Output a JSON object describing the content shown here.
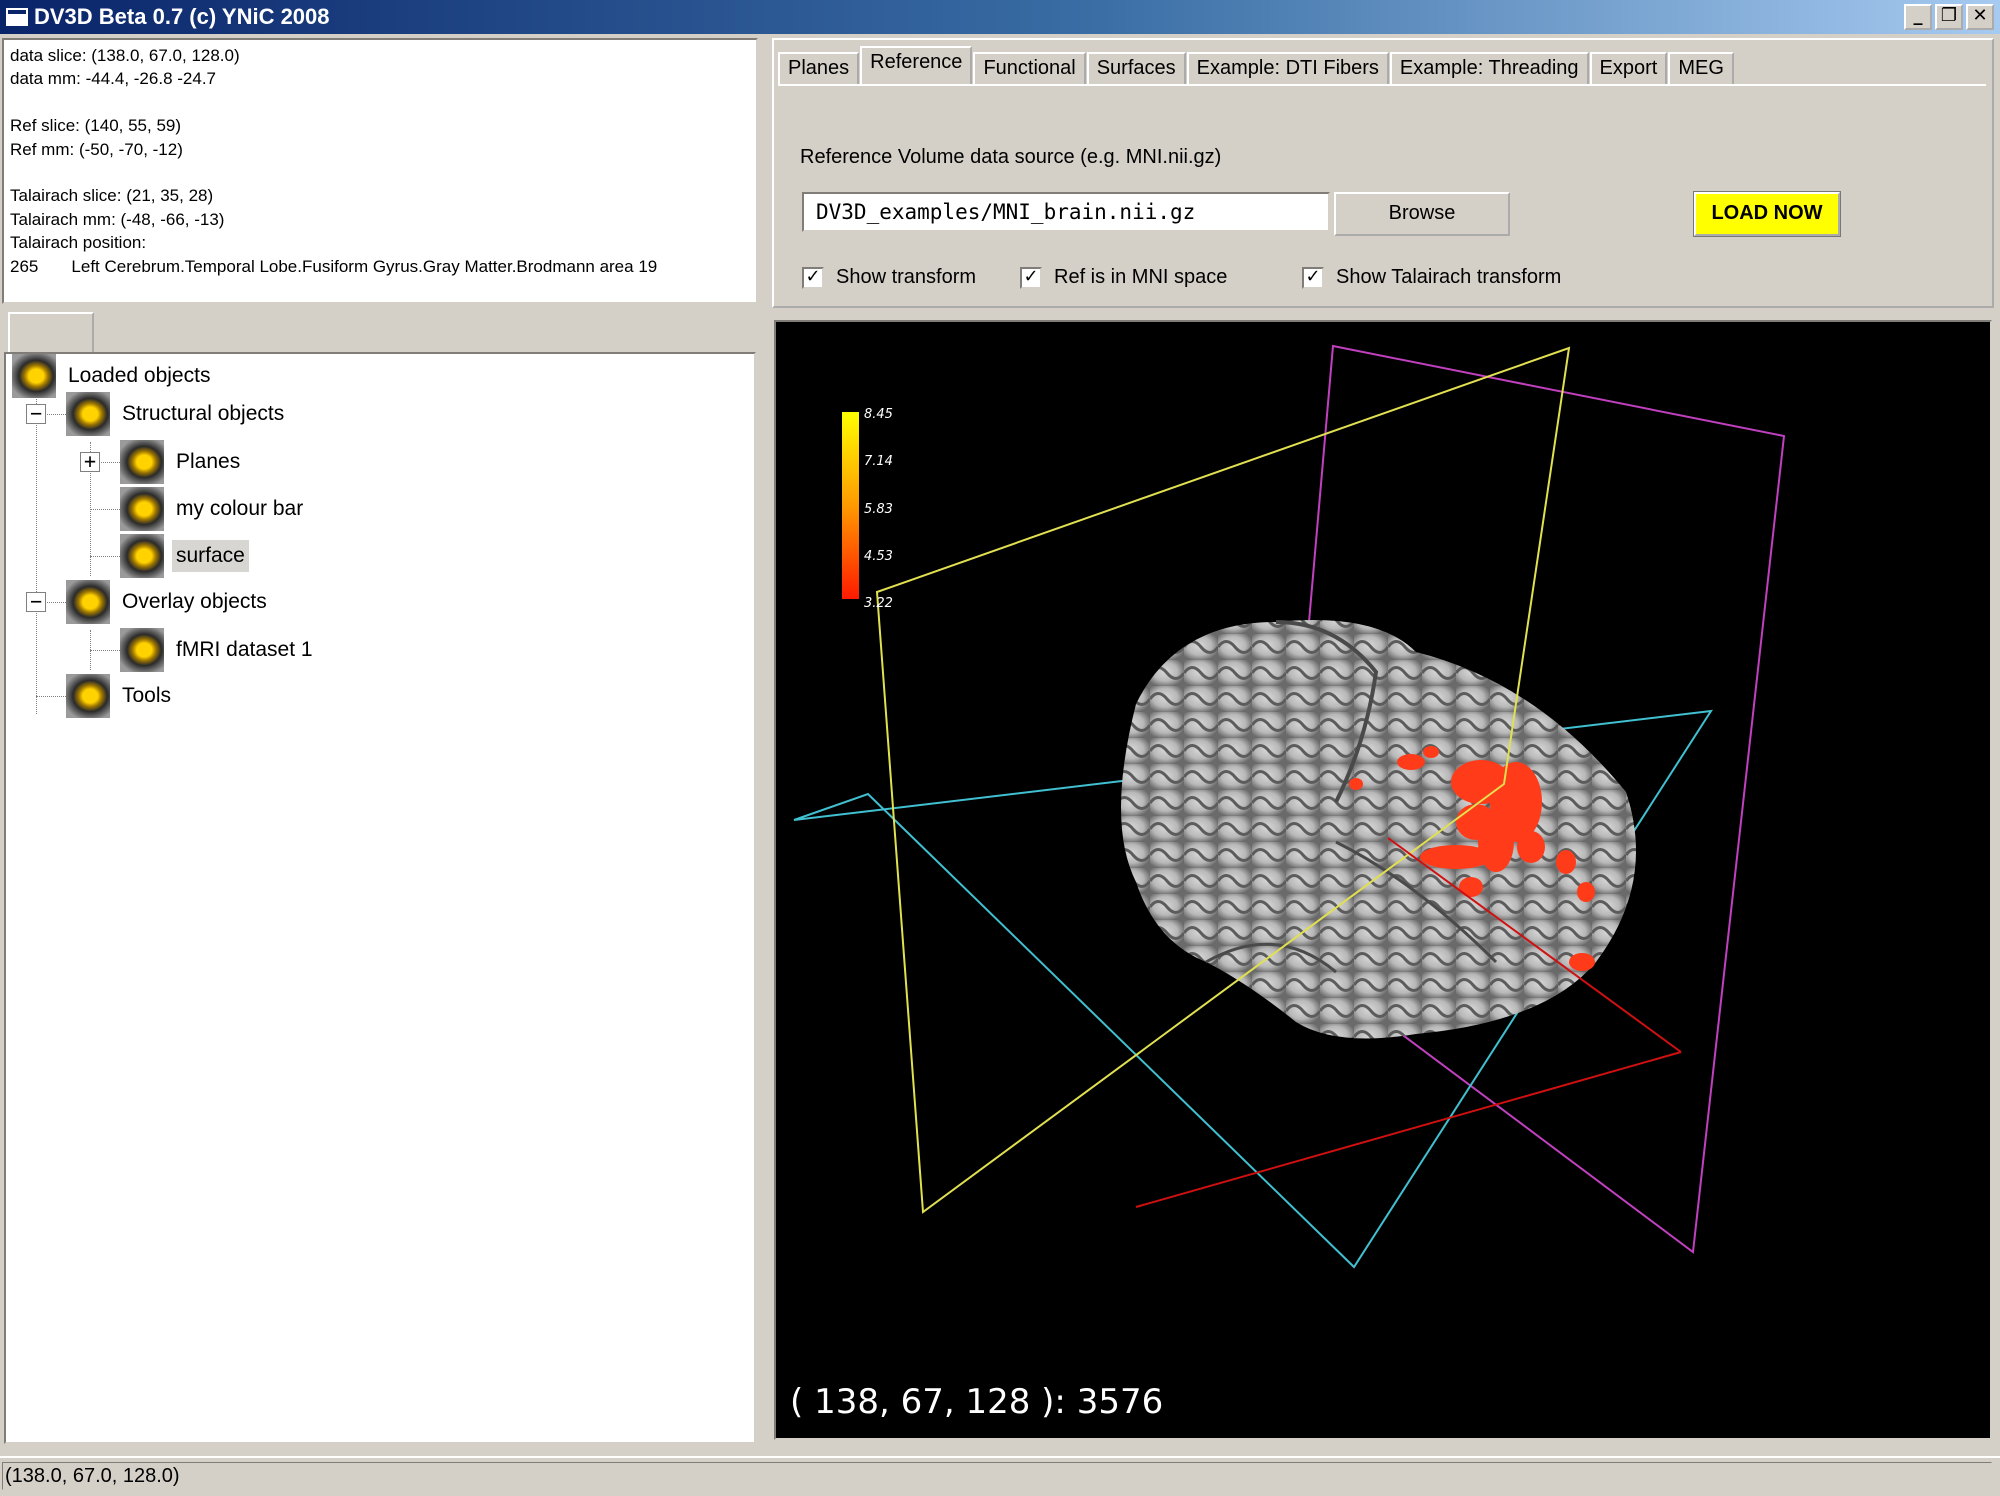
{
  "window": {
    "title": "DV3D Beta 0.7 (c) YNiC 2008",
    "minimize_glyph": "_",
    "restore_glyph": "❐",
    "close_glyph": "✕"
  },
  "info": {
    "lines": [
      "data slice: (138.0, 67.0, 128.0)",
      "data mm: -44.4, -26.8 -24.7",
      "",
      "Ref slice: (140, 55, 59)",
      "Ref mm: (-50, -70, -12)",
      "",
      "Talairach slice: (21, 35, 28)",
      "Talairach mm: (-48, -66, -13)",
      "Talairach position:",
      "265       Left Cerebrum.Temporal Lobe.Fusiform Gyrus.Gray Matter.Brodmann area 19"
    ]
  },
  "tree": {
    "root": "Loaded objects",
    "structural": "Structural objects",
    "planes": "Planes",
    "colour_bar": "my colour bar",
    "surface": "surface",
    "overlay": "Overlay objects",
    "fmri": "fMRI dataset 1",
    "tools": "Tools",
    "collapse_glyph": "−",
    "expand_glyph": "+"
  },
  "tabs": [
    "Planes",
    "Reference",
    "Functional",
    "Surfaces",
    "Example: DTI Fibers",
    "Example: Threading",
    "Export",
    "MEG"
  ],
  "reference": {
    "source_label": "Reference Volume data source (e.g. MNI.nii.gz)",
    "source_value": "DV3D_examples/MNI_brain.nii.gz",
    "browse_label": "Browse",
    "load_label": "LOAD NOW",
    "check_glyph": "✓",
    "show_transform": "Show transform",
    "ref_mni": "Ref is in MNI space",
    "show_talairach": "Show Talairach transform",
    "show_transform_checked": true,
    "ref_mni_checked": true,
    "show_talairach_checked": true
  },
  "viewport": {
    "colorbar_ticks": [
      "8.45",
      "7.14",
      "5.83",
      "4.53",
      "3.22"
    ],
    "cursor_readout": "( 138, 67, 128 ): 3576",
    "colors": {
      "sagittal_plane": "#e0e050",
      "coronal_plane": "#c040c0",
      "axial_plane": "#40c0d0",
      "cursor_line": "#d01010",
      "activation": "#ff3b1a"
    }
  },
  "status": {
    "text": "(138.0, 67.0, 128.0)"
  },
  "accent": "#ffff00"
}
